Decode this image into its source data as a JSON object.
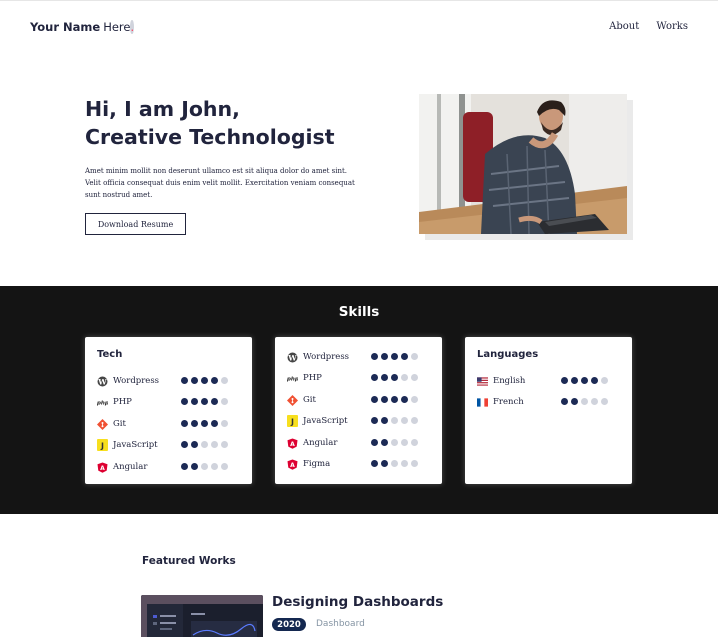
{
  "header": {
    "brand_name": "Your Name",
    "brand_suffix": "Here",
    "brand_dot": ".",
    "nav": [
      "About",
      "Works"
    ]
  },
  "hero": {
    "title_line1": "Hi, I am John,",
    "title_line2": "Creative Technologist",
    "description": "Amet minim mollit non deserunt ullamco est sit aliqua dolor do amet sint. Velit officia consequat duis enim velit mollit. Exercitation veniam consequat sunt nostrud amet.",
    "button_label": "Download Resume"
  },
  "skills": {
    "title": "Skills",
    "cards": [
      {
        "title": "Tech",
        "items": [
          {
            "name": "Wordpress",
            "icon": "wordpress-icon",
            "level": 4
          },
          {
            "name": "PHP",
            "icon": "php-icon",
            "level": 4
          },
          {
            "name": "Git",
            "icon": "git-icon",
            "level": 4
          },
          {
            "name": "JavaScript",
            "icon": "javascript-icon",
            "level": 2
          },
          {
            "name": "Angular",
            "icon": "angular-icon",
            "level": 2
          }
        ]
      },
      {
        "title": "",
        "items": [
          {
            "name": "Wordpress",
            "icon": "wordpress-icon",
            "level": 4
          },
          {
            "name": "PHP",
            "icon": "php-icon",
            "level": 3
          },
          {
            "name": "Git",
            "icon": "git-icon",
            "level": 4
          },
          {
            "name": "JavaScript",
            "icon": "javascript-icon",
            "level": 2
          },
          {
            "name": "Angular",
            "icon": "angular-icon",
            "level": 2
          },
          {
            "name": "Figma",
            "icon": "angular-icon",
            "level": 2
          }
        ]
      },
      {
        "title": "Languages",
        "items": [
          {
            "name": "English",
            "icon": "us-flag-icon",
            "level": 4
          },
          {
            "name": "French",
            "icon": "france-flag-icon",
            "level": 2
          }
        ]
      }
    ],
    "max_level": 5
  },
  "featured": {
    "title": "Featured Works",
    "work_title": "Designing Dashboards",
    "year": "2020",
    "tag": "Dashboard"
  },
  "colors": {
    "navy": "#21243d",
    "accent": "#ff3e5e",
    "dark_band": "#141414",
    "dot_on": "#1c2a55",
    "dot_off": "#d0d3dc",
    "badge": "#142850"
  }
}
